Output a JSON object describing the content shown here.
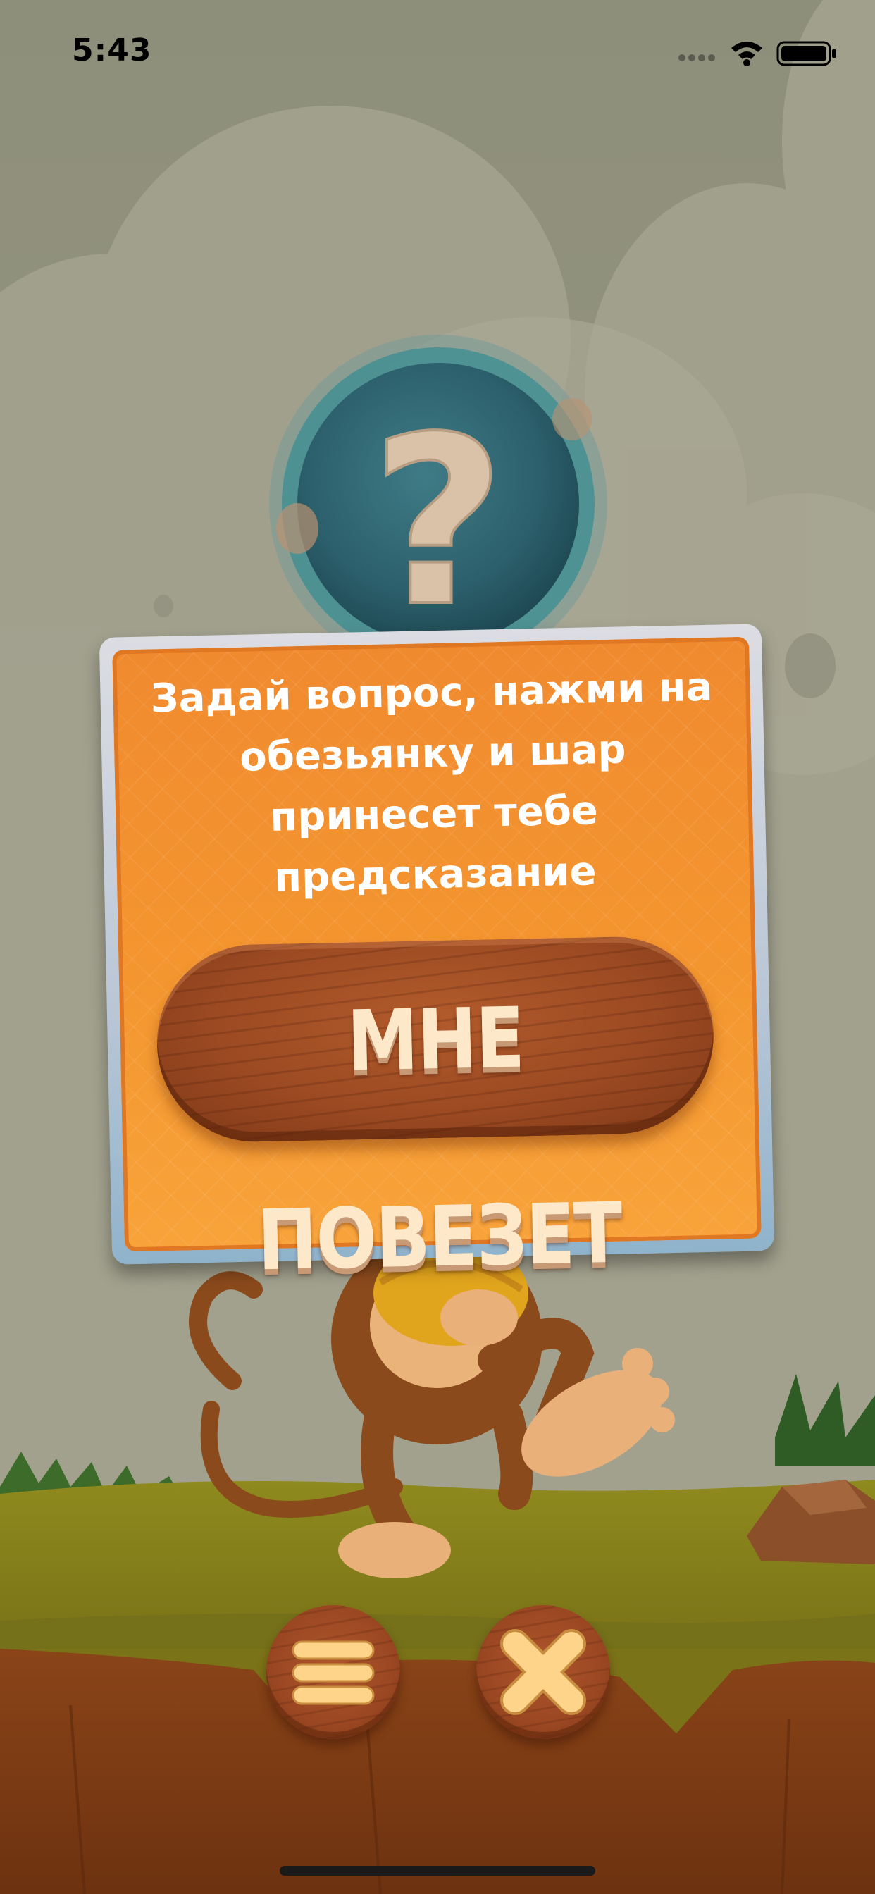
{
  "status_bar": {
    "time": "5:43",
    "icons": [
      "signal-icon",
      "wifi-icon",
      "battery-icon"
    ]
  },
  "ball": {
    "symbol": "?"
  },
  "dialog": {
    "message": "Задай вопрос, нажми на обезьянку и шар принесет тебе предсказание",
    "lucky_button_label": "МНЕ ПОВЕЗЕТ"
  },
  "bottom_bar": {
    "buttons": [
      {
        "name": "menu",
        "icon": "menu-icon"
      },
      {
        "name": "close",
        "icon": "close-icon"
      }
    ]
  },
  "colors": {
    "card_orange": "#f4962f",
    "wood_brown": "#9c4a22",
    "button_text": "#fde9c9",
    "icon_cream": "#fdd489",
    "background": "#8c8d78"
  }
}
